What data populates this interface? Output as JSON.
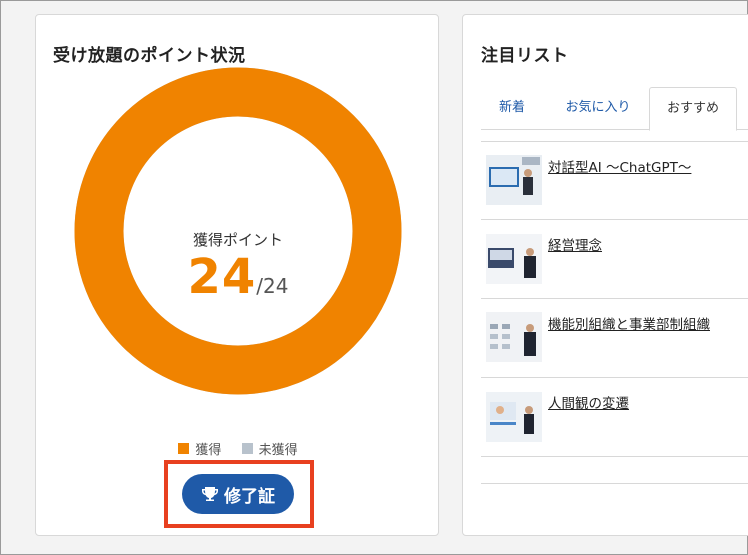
{
  "points_card": {
    "title": "受け放題のポイント状況",
    "label": "獲得ポイント",
    "acquired": "24",
    "total": "/24",
    "acquired_fraction": 1.0,
    "colors": {
      "acquired": "#f08300",
      "unacquired": "#b8c2cc"
    },
    "legend": [
      {
        "label": "獲得",
        "color": "#f08300"
      },
      {
        "label": "未獲得",
        "color": "#b8c2cc"
      }
    ],
    "certificate_button": "修了証",
    "certificate_icon": "trophy-icon"
  },
  "watch_card": {
    "title": "注目リスト",
    "tabs": [
      {
        "label": "新着",
        "active": false
      },
      {
        "label": "お気に入り",
        "active": false
      },
      {
        "label": "おすすめ",
        "active": true
      }
    ],
    "items": [
      {
        "title": "対話型AI ～ChatGPT～"
      },
      {
        "title": "経営理念"
      },
      {
        "title": "機能別組織と事業部制組織"
      },
      {
        "title": "人間観の変遷"
      }
    ]
  }
}
